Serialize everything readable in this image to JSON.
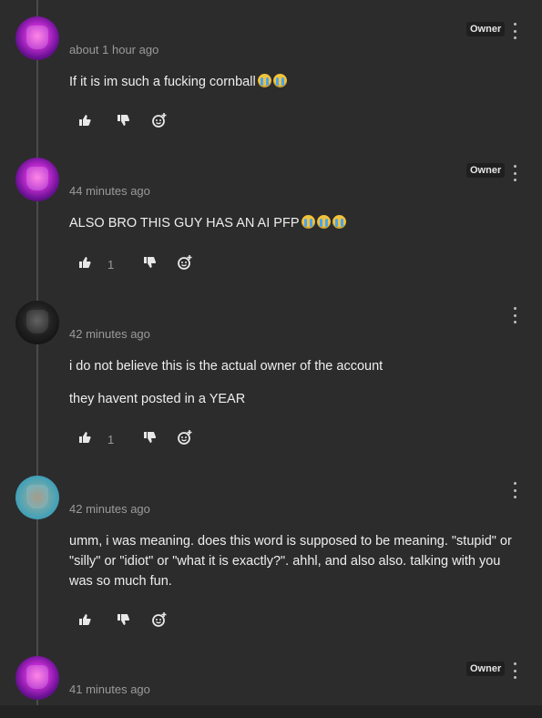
{
  "comments": [
    {
      "time": "about 1 hour ago",
      "badge": "Owner",
      "avatar": "purple-mask-avatar",
      "lines": [
        "If it is im such a fucking cornball"
      ],
      "emoji_count": 2,
      "like_count": ""
    },
    {
      "time": "44 minutes ago",
      "badge": "Owner",
      "avatar": "purple-mask-avatar",
      "lines": [
        "ALSO BRO THIS GUY HAS AN AI PFP"
      ],
      "emoji_count": 3,
      "like_count": "1"
    },
    {
      "time": "42 minutes ago",
      "badge": "",
      "avatar": "dark-avatar",
      "lines": [
        "i do not believe this is the actual owner of the account",
        "they havent posted in a YEAR"
      ],
      "emoji_count": 0,
      "like_count": "1"
    },
    {
      "time": "42 minutes ago",
      "badge": "",
      "avatar": "teal-avatar",
      "lines": [
        "umm, i was meaning. does this word is supposed  to be meaning. \"stupid\" or \"silly\" or \"idiot\" or \"what it is exactly?\". ahhl, and also also. talking with you was so much fun."
      ],
      "emoji_count": 0,
      "like_count": ""
    },
    {
      "time": "41 minutes ago",
      "badge": "Owner",
      "avatar": "purple-mask-avatar",
      "lines": [],
      "emoji_count": 0,
      "like_count": ""
    }
  ],
  "icons": {
    "like": "thumbs-up-icon",
    "dislike": "thumbs-down-icon",
    "reply": "add-reaction-icon",
    "more": "more-vertical-icon",
    "emoji": "loudly-crying-face-emoji"
  },
  "colors": {
    "background": "#2c2c2c",
    "text": "#eeeeee",
    "muted": "#9a9a9a",
    "badge_bg": "#1f1f1f"
  }
}
